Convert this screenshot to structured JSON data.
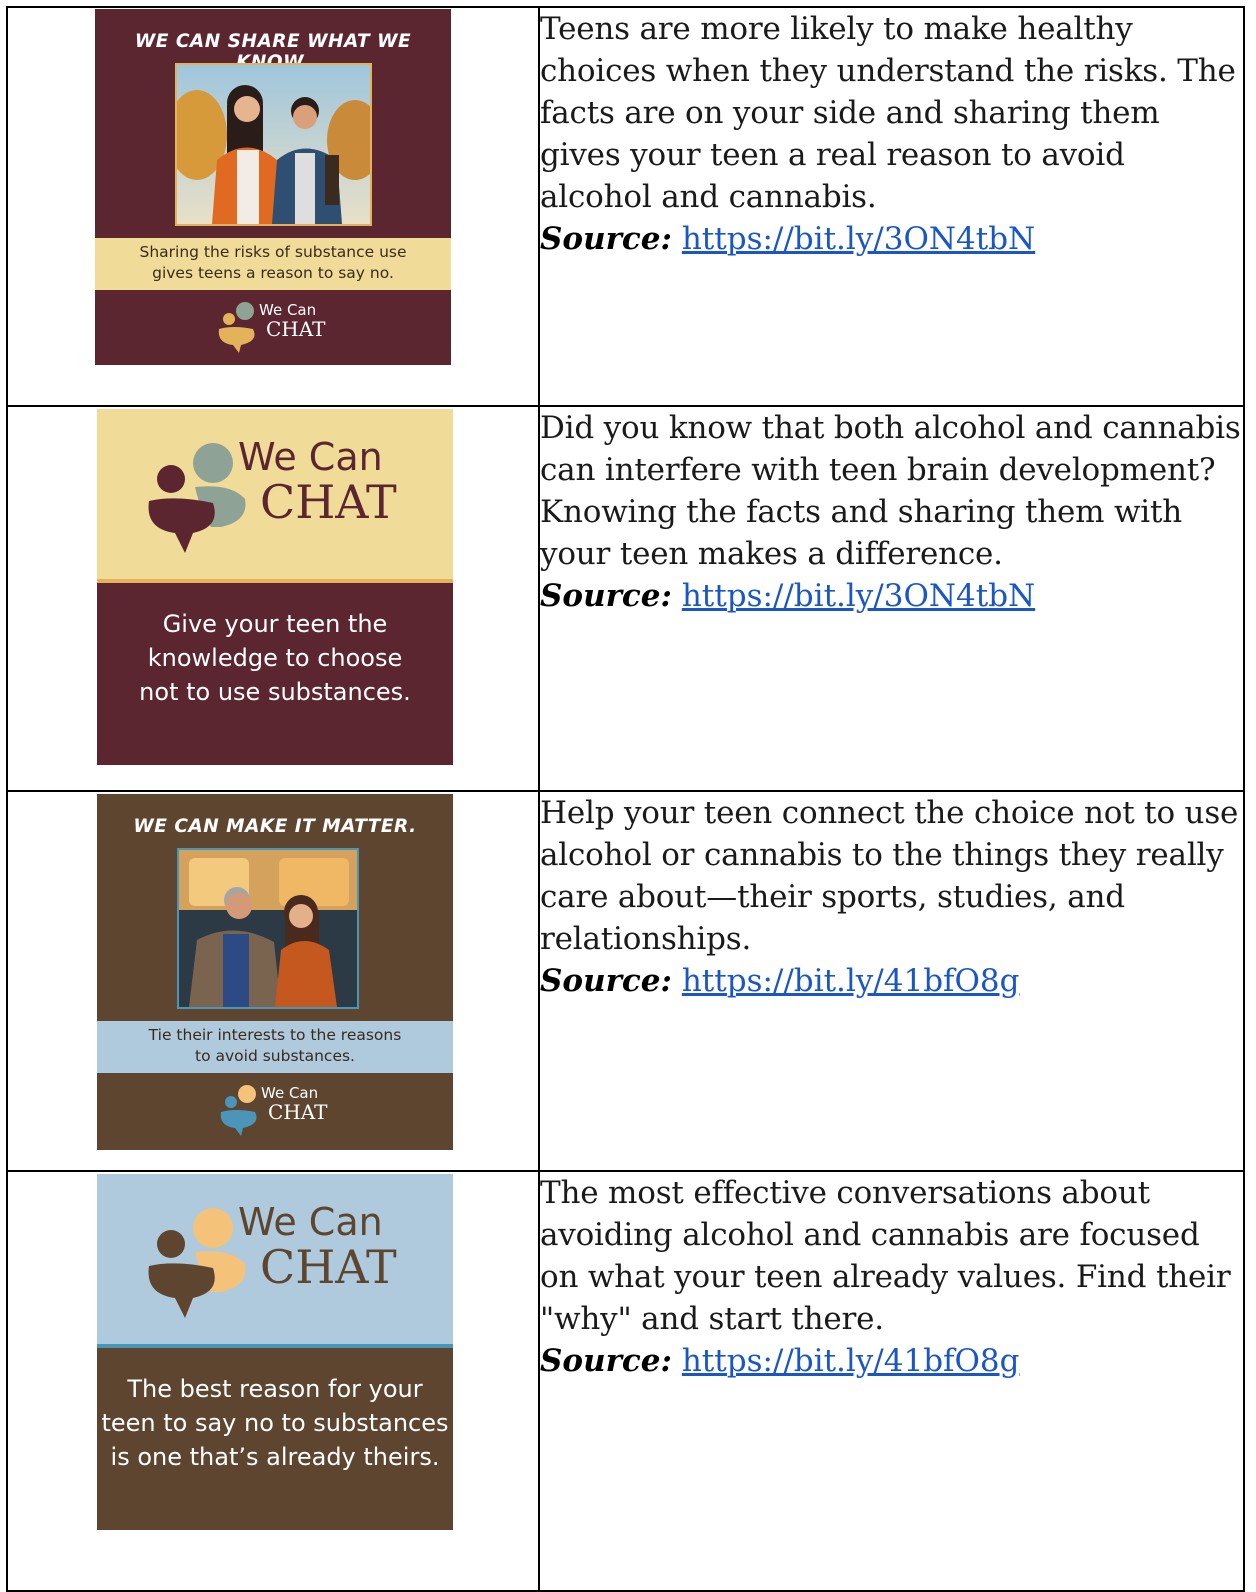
{
  "rows": [
    {
      "card": {
        "tagline": "WE CAN SHARE WHAT WE KNOW.",
        "band_line1": "Sharing the risks of substance use",
        "band_line2": "gives teens a reason to say no.",
        "logo_we": "We Can",
        "logo_chat": "CHAT"
      },
      "text": "Teens are more likely to make healthy choices when they understand the risks. The facts are on your side and sharing them gives your teen a real reason to avoid alcohol and cannabis.",
      "source_label": "Source:",
      "source_url": "https://bit.ly/3ON4tbN"
    },
    {
      "card": {
        "logo_we": "We Can",
        "logo_chat": "CHAT",
        "line1": "Give your teen the",
        "line2": "knowledge to choose",
        "line3": "not to use substances."
      },
      "text": "Did you know that both alcohol and cannabis can interfere with teen brain development? Knowing the facts and sharing them with your teen makes a difference.",
      "source_label": "Source:",
      "source_url": "https://bit.ly/3ON4tbN"
    },
    {
      "card": {
        "tagline": "WE CAN MAKE IT MATTER.",
        "band_line1": "Tie their interests to the reasons",
        "band_line2": "to avoid substances.",
        "logo_we": "We Can",
        "logo_chat": "CHAT"
      },
      "text": "Help your teen connect the choice not to use alcohol or cannabis to the things they really care about—their sports, studies, and relationships.",
      "source_label": "Source:",
      "source_url": "https://bit.ly/41bfO8g"
    },
    {
      "card": {
        "logo_we": "We Can",
        "logo_chat": "CHAT",
        "line1": "The best reason for your",
        "line2": "teen to say no to substances",
        "line3": "is one that’s already theirs."
      },
      "text": "The most effective conversations about avoiding alcohol and cannabis are focused on what your teen already values. Find their \"why\" and start there.",
      "source_label": "Source:",
      "source_url": "https://bit.ly/41bfO8g"
    }
  ],
  "colors": {
    "maroon": "#5c2631",
    "cream": "#f0dc98",
    "sage": "#8ea396",
    "brown": "#5e4530",
    "lightblue": "#aecadc",
    "peach": "#f5c27a",
    "teal": "#4b95b8",
    "gold": "#e2b35a",
    "link": "#1a56c8"
  }
}
